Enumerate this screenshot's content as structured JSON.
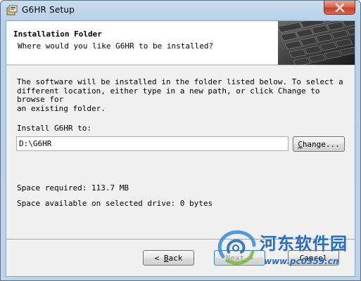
{
  "window": {
    "title": "G6HR Setup",
    "close_glyph": "✕"
  },
  "header": {
    "title": "Installation Folder",
    "subtitle": "Where would you like G6HR to be installed?"
  },
  "body": {
    "description": "The software will be installed in the folder listed below. To select a\ndifferent location, either type in a new path, or click Change to browse for\nan existing folder.",
    "install_label": "Install G6HR to:",
    "path_value": "D:\\G6HR",
    "change_button": {
      "prefix": "",
      "mnemonic": "C",
      "rest": "hange..."
    },
    "space_required": "Space required: 113.7 MB",
    "space_available": "Space available on selected drive: 0 bytes"
  },
  "footer": {
    "back_button": {
      "arrow": "<",
      "mnemonic": "B",
      "rest": "ack"
    },
    "next_button": {
      "mnemonic": "N",
      "rest": "ext >"
    },
    "cancel_button": {
      "label": "Cancel"
    }
  },
  "watermark": {
    "chinese_text": "河东软件园",
    "url": "www.pc0359.cn"
  },
  "colors": {
    "titlebar": "#b7cfe8",
    "close_button": "#c8412a",
    "watermark": "#2a6db8"
  },
  "icons": {
    "app": "setup-package-icon",
    "close": "close-icon",
    "banner": "keyboard-image",
    "watermark_logo": "swirl-logo-icon"
  }
}
